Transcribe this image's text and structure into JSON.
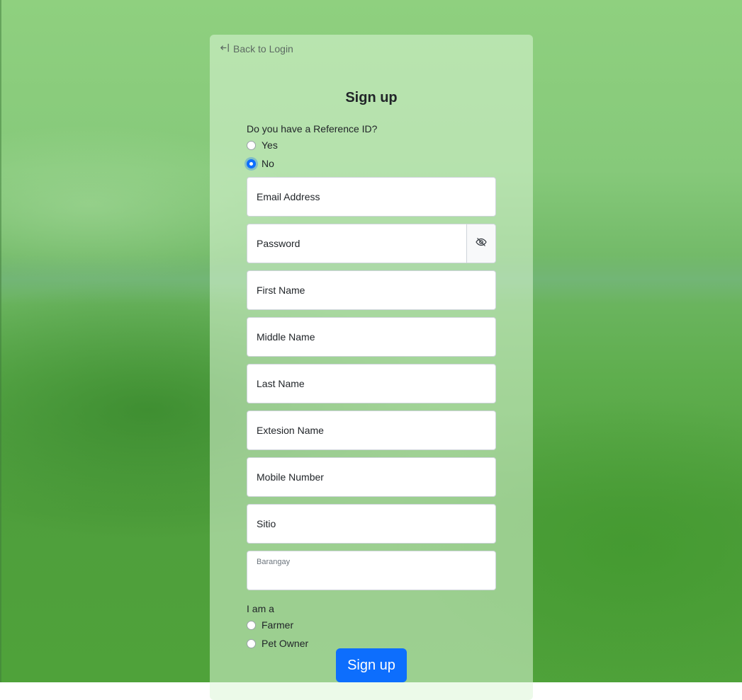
{
  "back_link": {
    "label": "Back to Login",
    "icon": "arrow-left-bar-icon"
  },
  "title": "Sign up",
  "reference": {
    "question": "Do you have a Reference ID?",
    "options": [
      {
        "label": "Yes",
        "checked": false
      },
      {
        "label": "No",
        "checked": true
      }
    ]
  },
  "fields": {
    "email": "Email Address",
    "password": "Password",
    "password_toggle_icon": "eye-slash-icon",
    "first_name": "First Name",
    "middle_name": "Middle Name",
    "last_name": "Last Name",
    "extension_name": "Extesion Name",
    "mobile": "Mobile Number",
    "sitio": "Sitio",
    "barangay": "Barangay"
  },
  "role": {
    "question": "I am a",
    "options": [
      {
        "label": "Farmer",
        "checked": false
      },
      {
        "label": "Pet Owner",
        "checked": false
      }
    ]
  },
  "submit_label": "Sign up",
  "colors": {
    "primary": "#0d6efd",
    "background_green": "#6fb765"
  }
}
